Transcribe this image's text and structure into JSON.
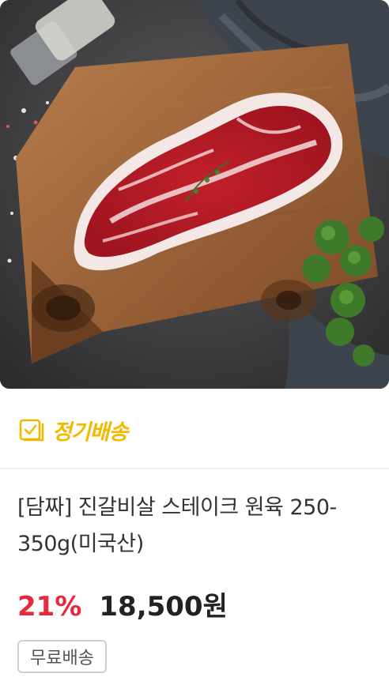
{
  "product": {
    "image_alt": "steak photo",
    "badge": {
      "icon": "calendar-check-icon",
      "label": "정기배송",
      "color": "#f5b800"
    },
    "title": "[담짜] 진갈비살 스테이크 원육 250-350g(미국산)",
    "discount": "21%",
    "price": "18,500원",
    "shipping_tag": "무료배송",
    "colors": {
      "discount": "#e8283c",
      "price": "#222222"
    }
  }
}
